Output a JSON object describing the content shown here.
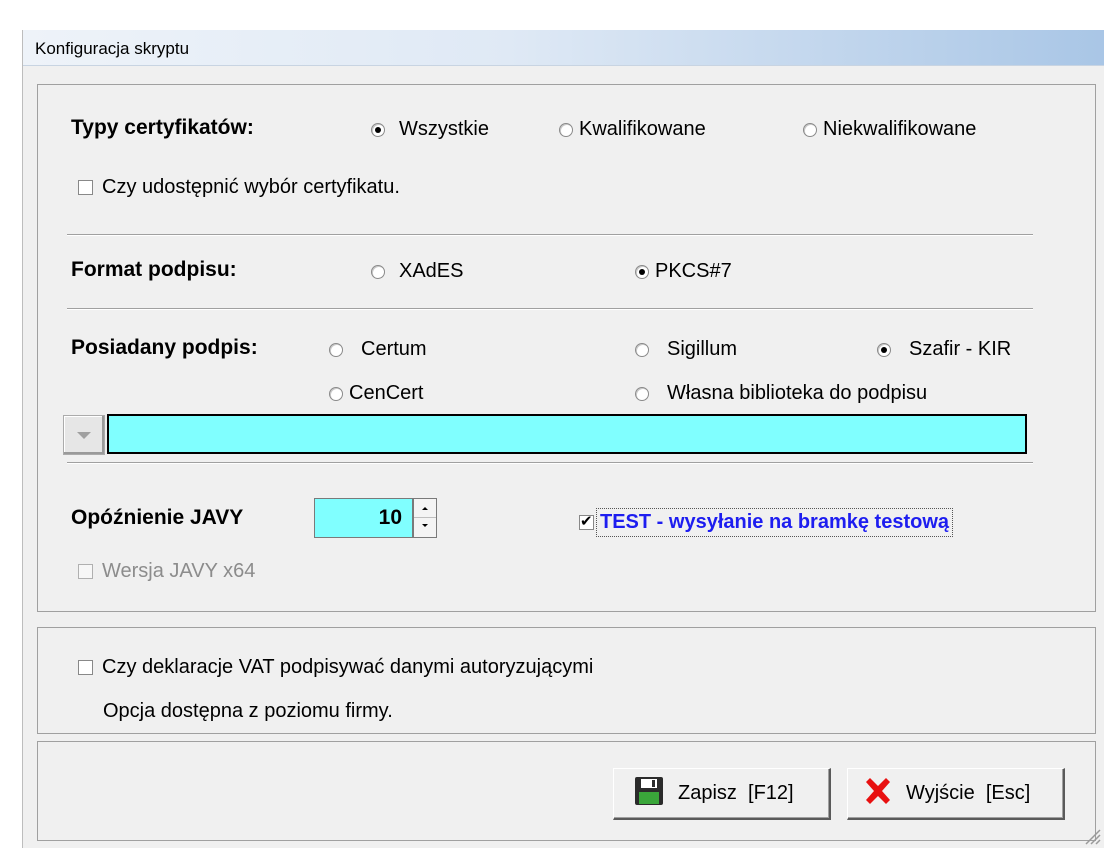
{
  "window": {
    "title": "Konfiguracja skryptu"
  },
  "certificates": {
    "label": "Typy certyfikatów:",
    "options": [
      "Wszystkie",
      "Kwalifikowane",
      "Niekwalifikowane"
    ],
    "selected": "Wszystkie",
    "share_choice_label": "Czy udostępnić wybór certyfikatu.",
    "share_choice_checked": false
  },
  "signature_format": {
    "label": "Format podpisu:",
    "options": [
      "XAdES",
      "PKCS#7"
    ],
    "selected": "PKCS#7"
  },
  "owned_signature": {
    "label": "Posiadany podpis:",
    "options": [
      "Certum",
      "Sigillum",
      "Szafir - KIR",
      "CenCert",
      "Własna biblioteka do podpisu"
    ],
    "selected": "Szafir - KIR",
    "library_path": ""
  },
  "java": {
    "delay_label": "Opóźnienie JAVY",
    "delay_value": "10",
    "x64_label": "Wersja JAVY x64",
    "x64_checked": false,
    "x64_enabled": false
  },
  "test": {
    "label": "TEST - wysyłanie na bramkę testową",
    "checked": true
  },
  "vat": {
    "label": "Czy deklaracje VAT podpisywać danymi autoryzującymi",
    "checked": false,
    "note": "Opcja dostępna z poziomu firmy."
  },
  "buttons": {
    "save_label": "Zapisz  [F12]",
    "exit_label": "Wyjście  [Esc]"
  },
  "colors": {
    "field_bg": "#80ffff",
    "test_text": "#1d1df0",
    "exit_icon": "#e81010",
    "save_icon": "#3aa63a"
  }
}
